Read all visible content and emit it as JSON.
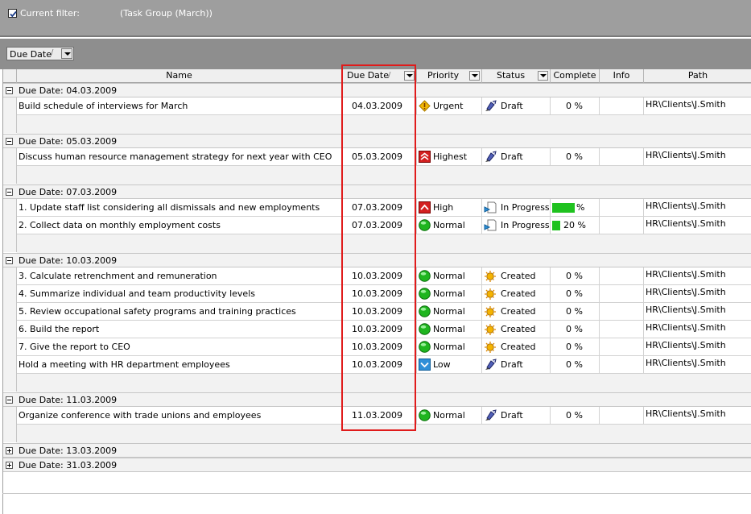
{
  "filter": {
    "checked": true,
    "label": "Current filter:",
    "value": "(Task Group  (March))"
  },
  "group_panel": {
    "chip_label": "Due Date",
    "chip_sort": "/"
  },
  "columns": {
    "name": "Name",
    "due": "Due Date",
    "due_sort": "/",
    "priority": "Priority",
    "status": "Status",
    "complete": "Complete",
    "info": "Info",
    "path": "Path"
  },
  "groups": [
    {
      "label": "Due Date: 04.03.2009",
      "expanded": true,
      "rows": [
        {
          "name": "Build schedule of interviews for March",
          "due": "04.03.2009",
          "priority": "Urgent",
          "priority_icon": "urgent-icon",
          "status": "Draft",
          "status_icon": "draft-icon",
          "complete": "0 %",
          "path": "HR\\Clients\\J.Smith"
        }
      ]
    },
    {
      "label": "Due Date: 05.03.2009",
      "expanded": true,
      "rows": [
        {
          "name": "Discuss human resource management strategy for next year with CEO",
          "due": "05.03.2009",
          "priority": "Highest",
          "priority_icon": "highest-icon",
          "status": "Draft",
          "status_icon": "draft-icon",
          "complete": "0 %",
          "path": "HR\\Clients\\J.Smith"
        }
      ]
    },
    {
      "label": "Due Date: 07.03.2009",
      "expanded": true,
      "rows": [
        {
          "name": "1. Update staff list considering all dismissals and new employments",
          "due": "07.03.2009",
          "priority": "High",
          "priority_icon": "high-icon",
          "status": "In Progress",
          "status_icon": "in-progress-icon",
          "complete": "%",
          "complete_fraction": 1.0,
          "path": "HR\\Clients\\J.Smith"
        },
        {
          "name": "2. Collect data on monthly employment costs",
          "due": "07.03.2009",
          "priority": "Normal",
          "priority_icon": "normal-icon",
          "status": "In Progress",
          "status_icon": "in-progress-icon",
          "complete": "20 %",
          "complete_fraction": 0.2,
          "path": "HR\\Clients\\J.Smith"
        }
      ]
    },
    {
      "label": "Due Date: 10.03.2009",
      "expanded": true,
      "rows": [
        {
          "name": "3. Calculate retrenchment and remuneration",
          "due": "10.03.2009",
          "priority": "Normal",
          "priority_icon": "normal-icon",
          "status": "Created",
          "status_icon": "created-icon",
          "complete": "0 %",
          "path": "HR\\Clients\\J.Smith"
        },
        {
          "name": "4. Summarize individual and team productivity levels",
          "due": "10.03.2009",
          "priority": "Normal",
          "priority_icon": "normal-icon",
          "status": "Created",
          "status_icon": "created-icon",
          "complete": "0 %",
          "path": "HR\\Clients\\J.Smith"
        },
        {
          "name": "5. Review occupational safety programs and training practices",
          "due": "10.03.2009",
          "priority": "Normal",
          "priority_icon": "normal-icon",
          "status": "Created",
          "status_icon": "created-icon",
          "complete": "0 %",
          "path": "HR\\Clients\\J.Smith"
        },
        {
          "name": "6. Build the report",
          "due": "10.03.2009",
          "priority": "Normal",
          "priority_icon": "normal-icon",
          "status": "Created",
          "status_icon": "created-icon",
          "complete": "0 %",
          "path": "HR\\Clients\\J.Smith"
        },
        {
          "name": "7. Give the report to CEO",
          "due": "10.03.2009",
          "priority": "Normal",
          "priority_icon": "normal-icon",
          "status": "Created",
          "status_icon": "created-icon",
          "complete": "0 %",
          "path": "HR\\Clients\\J.Smith"
        },
        {
          "name": "Hold a meeting with HR department employees",
          "due": "10.03.2009",
          "priority": "Low",
          "priority_icon": "low-icon",
          "status": "Draft",
          "status_icon": "draft-icon",
          "complete": "0 %",
          "path": "HR\\Clients\\J.Smith"
        }
      ]
    },
    {
      "label": "Due Date: 11.03.2009",
      "expanded": true,
      "rows": [
        {
          "name": "Organize conference with trade unions and employees",
          "due": "11.03.2009",
          "priority": "Normal",
          "priority_icon": "normal-icon",
          "status": "Draft",
          "status_icon": "draft-icon",
          "complete": "0 %",
          "path": "HR\\Clients\\J.Smith"
        }
      ]
    },
    {
      "label": "Due Date: 13.03.2009",
      "expanded": false,
      "rows": []
    },
    {
      "label": "Due Date: 31.03.2009",
      "expanded": false,
      "rows": []
    }
  ],
  "colors": {
    "highlight": "#e01b1b",
    "progress": "#1fc21f",
    "toolbar": "#9e9e9e"
  }
}
